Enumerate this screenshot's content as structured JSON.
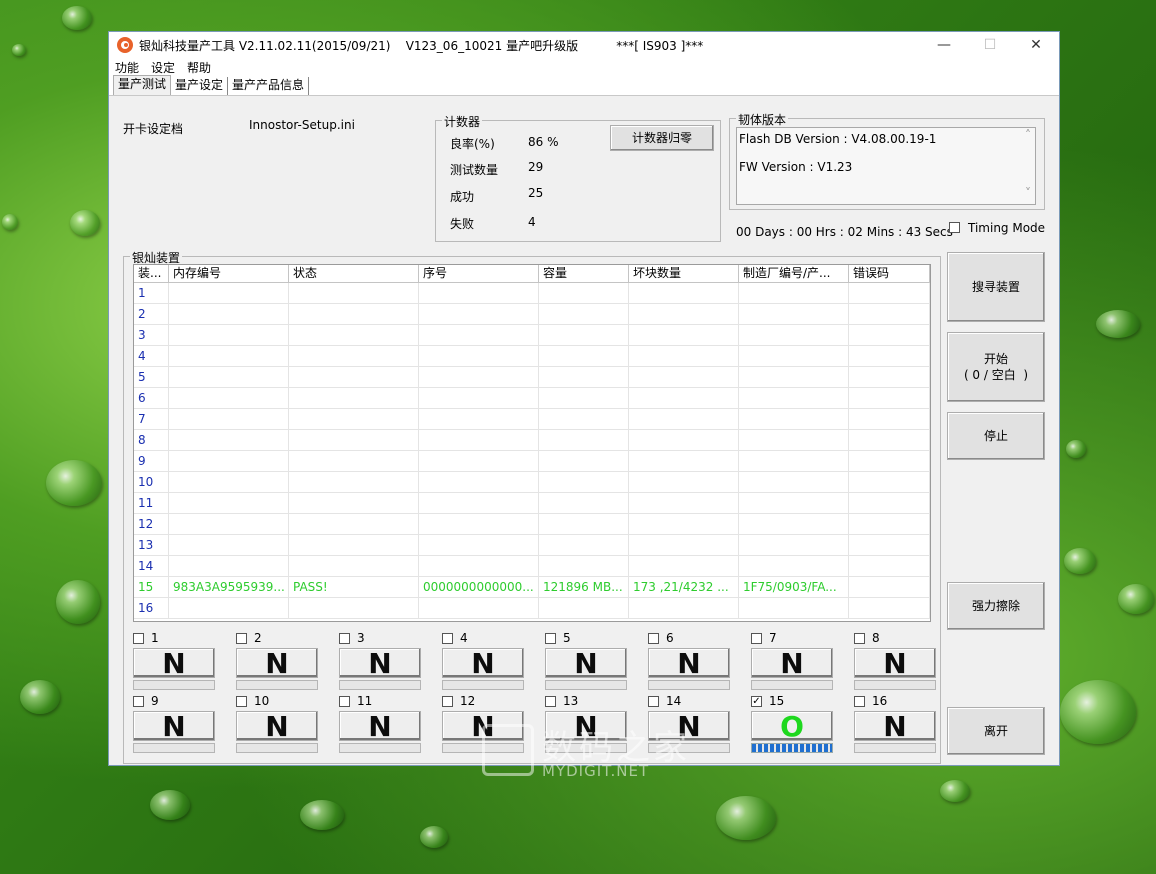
{
  "window": {
    "title": "银灿科技量产工具 V2.11.02.11(2015/09/21)    V123_06_10021 量产吧升级版          ***[ IS903 ]***",
    "minimize": "—",
    "maximize": "☐",
    "close": "✕"
  },
  "menu": [
    "功能",
    "设定",
    "帮助"
  ],
  "tabs": [
    "量产测试",
    "量产设定",
    "量产产品信息"
  ],
  "config": {
    "label": "开卡设定档",
    "value": "Innostor-Setup.ini"
  },
  "counter": {
    "title": "计数器",
    "reset_button": "计数器归零",
    "rows": [
      {
        "label": "良率(%)",
        "value": "86 %"
      },
      {
        "label": "测试数量",
        "value": "29"
      },
      {
        "label": "成功",
        "value": "25"
      },
      {
        "label": "失败",
        "value": "4"
      }
    ]
  },
  "firmware": {
    "title": "韧体版本",
    "flash_db": "Flash DB Version :  V4.08.00.19-1",
    "fw": "FW Version :    V1.23",
    "scroll_up": "˄",
    "scroll_down": "˅"
  },
  "timer": "00 Days : 00 Hrs : 02 Mins : 43 Secs",
  "timing_mode": "Timing Mode",
  "devices": {
    "title": "银灿装置",
    "columns": [
      "装...",
      "内存编号",
      "状态",
      "序号",
      "容量",
      "坏块数量",
      "制造厂编号/产...",
      "错误码"
    ],
    "rows": [
      [
        "1",
        "",
        "",
        "",
        "",
        "",
        "",
        ""
      ],
      [
        "2",
        "",
        "",
        "",
        "",
        "",
        "",
        ""
      ],
      [
        "3",
        "",
        "",
        "",
        "",
        "",
        "",
        ""
      ],
      [
        "4",
        "",
        "",
        "",
        "",
        "",
        "",
        ""
      ],
      [
        "5",
        "",
        "",
        "",
        "",
        "",
        "",
        ""
      ],
      [
        "6",
        "",
        "",
        "",
        "",
        "",
        "",
        ""
      ],
      [
        "7",
        "",
        "",
        "",
        "",
        "",
        "",
        ""
      ],
      [
        "8",
        "",
        "",
        "",
        "",
        "",
        "",
        ""
      ],
      [
        "9",
        "",
        "",
        "",
        "",
        "",
        "",
        ""
      ],
      [
        "10",
        "",
        "",
        "",
        "",
        "",
        "",
        ""
      ],
      [
        "11",
        "",
        "",
        "",
        "",
        "",
        "",
        ""
      ],
      [
        "12",
        "",
        "",
        "",
        "",
        "",
        "",
        ""
      ],
      [
        "13",
        "",
        "",
        "",
        "",
        "",
        "",
        ""
      ],
      [
        "14",
        "",
        "",
        "",
        "",
        "",
        "",
        ""
      ],
      [
        "15",
        "983A3A9595939...",
        "PASS!",
        "0000000000000...",
        "121896 MB...",
        "173 ,21/4232 ...",
        "1F75/0903/FA...",
        ""
      ],
      [
        "16",
        "",
        "",
        "",
        "",
        "",
        "",
        ""
      ]
    ]
  },
  "buttons": {
    "search": "搜寻装置",
    "start_line1": "开始",
    "start_line2": "( 0 / 空白  )",
    "stop": "停止",
    "erase": "强力擦除",
    "exit": "离开"
  },
  "slots": [
    {
      "num": "1",
      "status": "N",
      "checked": false,
      "progress": 0
    },
    {
      "num": "2",
      "status": "N",
      "checked": false,
      "progress": 0
    },
    {
      "num": "3",
      "status": "N",
      "checked": false,
      "progress": 0
    },
    {
      "num": "4",
      "status": "N",
      "checked": false,
      "progress": 0
    },
    {
      "num": "5",
      "status": "N",
      "checked": false,
      "progress": 0
    },
    {
      "num": "6",
      "status": "N",
      "checked": false,
      "progress": 0
    },
    {
      "num": "7",
      "status": "N",
      "checked": false,
      "progress": 0
    },
    {
      "num": "8",
      "status": "N",
      "checked": false,
      "progress": 0
    },
    {
      "num": "9",
      "status": "N",
      "checked": false,
      "progress": 0
    },
    {
      "num": "10",
      "status": "N",
      "checked": false,
      "progress": 0
    },
    {
      "num": "11",
      "status": "N",
      "checked": false,
      "progress": 0
    },
    {
      "num": "12",
      "status": "N",
      "checked": false,
      "progress": 0
    },
    {
      "num": "13",
      "status": "N",
      "checked": false,
      "progress": 0
    },
    {
      "num": "14",
      "status": "N",
      "checked": false,
      "progress": 0
    },
    {
      "num": "15",
      "status": "O",
      "checked": true,
      "progress": 1
    },
    {
      "num": "16",
      "status": "N",
      "checked": false,
      "progress": 0
    }
  ],
  "watermark": {
    "cn": "数码之家",
    "en": "MYDIGIT.NET"
  },
  "colors": {
    "pass_text": "#2ecc2e",
    "row_number": "#1a2fb0",
    "progress": "#1f6fd0"
  }
}
